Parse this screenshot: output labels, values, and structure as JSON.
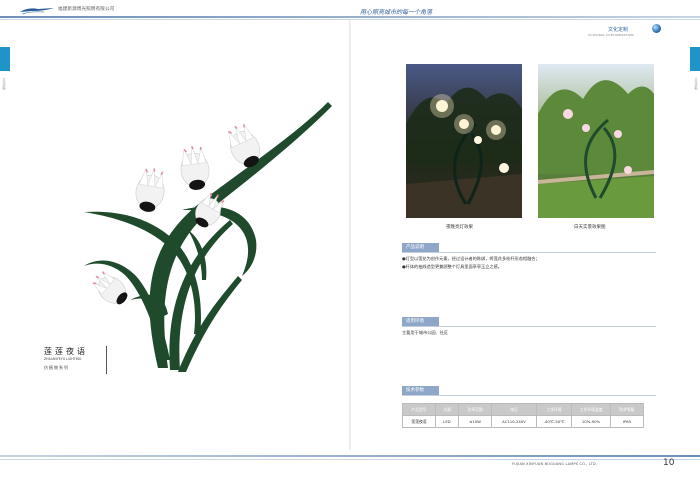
{
  "header": {
    "company": "福建新源博光照明有限公司",
    "slogan": "用心照亮城市的每一个角落",
    "brand": "文化定制",
    "brand_sub": "CULTURAL CUSTOMIZATION"
  },
  "side_tabs": {
    "left": "文化定制",
    "right": "文化定制"
  },
  "product": {
    "name_cn": "莲莲夜语",
    "name_en": "ZHILIANYEYU LIGHTING",
    "series": "仿植物系列"
  },
  "photos": [
    {
      "caption": "夜晚亮灯效果"
    },
    {
      "caption": "白天实景效果图"
    }
  ],
  "sections": {
    "description": {
      "title": "产品说明",
      "lines": [
        "●灯型以莲花为创作元素，经过设计者的陈绑，将莲花多枝杆形态相融合；",
        "●杆体的抽线造型更兼顾整个灯具里面亭亭玉立之感。"
      ]
    },
    "usage": {
      "title": "适用环境",
      "text": "主要用于城市公园、社区"
    },
    "specs": {
      "title": "技术参数",
      "headers": [
        "产品型号",
        "光源",
        "功率范围",
        "电压",
        "工作环境",
        "工作环境湿度",
        "防护等级"
      ],
      "rows": [
        [
          "莲莲夜语",
          "LED",
          "≤10W",
          "AC110-240V",
          "-40℃-50℃",
          "10%-90%",
          "IP65"
        ]
      ]
    }
  },
  "footer": {
    "company_en": "FUJIAN XINYUAN BOGUANG LAMPS CO., LTD.",
    "page": "10"
  },
  "colors": {
    "accent": "#1f94c8",
    "section": "#8ea7c8",
    "stem": "#1f4a2c"
  }
}
